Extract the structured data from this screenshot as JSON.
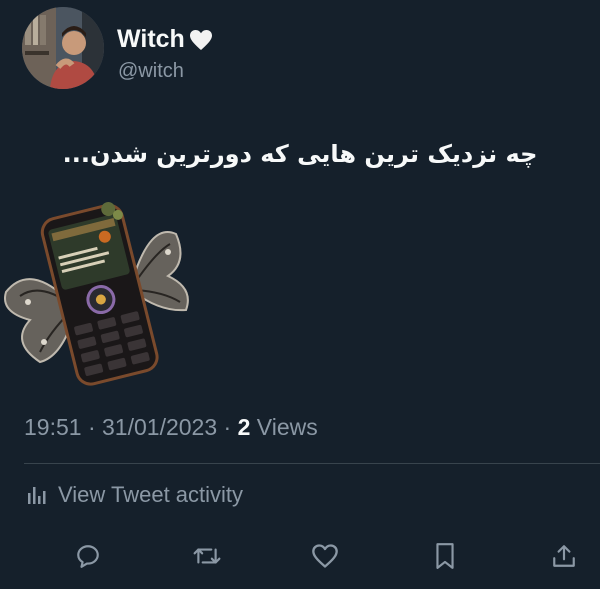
{
  "author": {
    "display_name": "Witch",
    "handle": "@witch",
    "avatar_icon": "user-photo",
    "name_emoji": "white-heart-icon"
  },
  "tweet": {
    "text": "چه نزدیک ترین هایی که دورترین شدن...",
    "media_icon": "phone-with-butterflies-sticker"
  },
  "meta": {
    "time": "19:51",
    "date": "31/01/2023",
    "views_count": "2",
    "views_label": "Views"
  },
  "activity": {
    "label": "View Tweet activity",
    "icon": "bar-chart-icon"
  },
  "actions": [
    {
      "name": "reply",
      "icon": "reply-icon"
    },
    {
      "name": "retweet",
      "icon": "retweet-icon"
    },
    {
      "name": "like",
      "icon": "heart-icon"
    },
    {
      "name": "bookmark",
      "icon": "bookmark-icon"
    },
    {
      "name": "share",
      "icon": "share-icon"
    }
  ],
  "colors": {
    "background": "#15202b",
    "text_primary": "#f7f9f9",
    "text_secondary": "#8b98a5",
    "divider": "#38444d"
  }
}
